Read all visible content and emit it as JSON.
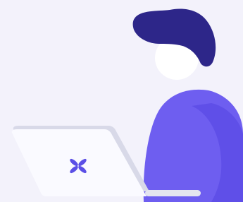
{
  "illustration": {
    "subject": "person-with-laptop",
    "icons": {
      "laptop_logo": "flower-logo-icon"
    },
    "colors": {
      "background": "#f3f2fb",
      "hair": "#2d2689",
      "face": "#ffffff",
      "body": "#6e5ef0",
      "body_shadow": "#5f4fe8",
      "laptop_screen": "#fafaff",
      "laptop_edge": "#d8d9e8",
      "laptop_base": "#e4e5ef",
      "logo": "#5b4fe6"
    }
  }
}
